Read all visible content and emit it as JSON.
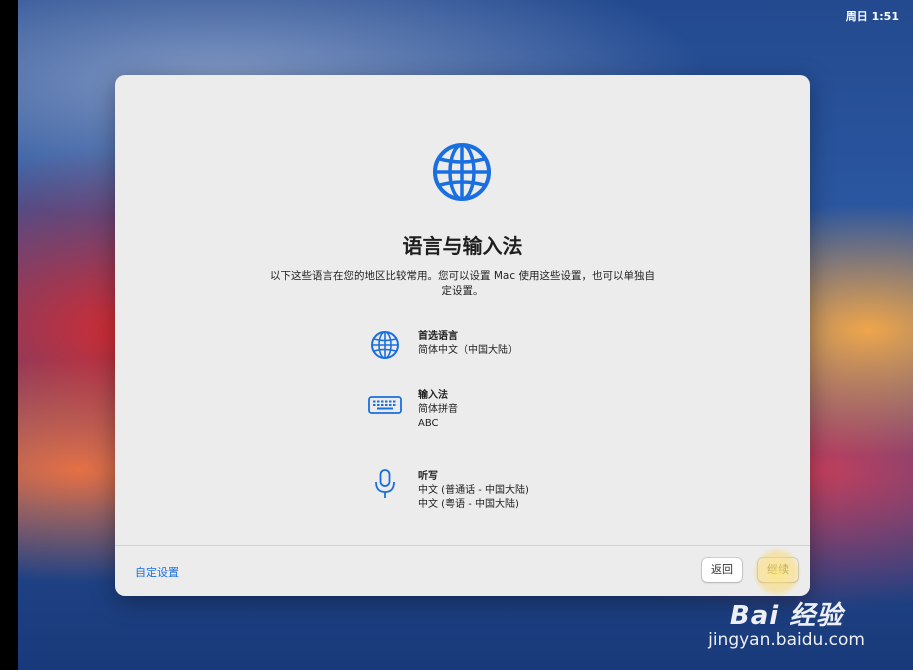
{
  "menubar": {
    "clock": "周日 1:51"
  },
  "dialog": {
    "title": "语言与输入法",
    "description": "以下这些语言在您的地区比较常用。您可以设置 Mac 使用这些设置，也可以单独自定设置。",
    "sections": [
      {
        "icon": "globe-icon",
        "heading": "首选语言",
        "lines": [
          "简体中文（中国大陆）"
        ]
      },
      {
        "icon": "keyboard-icon",
        "heading": "输入法",
        "lines": [
          "简体拼音",
          "ABC"
        ]
      },
      {
        "icon": "microphone-icon",
        "heading": "听写",
        "lines": [
          "中文 (普通话 - 中国大陆)",
          "中文 (粤语 - 中国大陆)"
        ]
      }
    ],
    "customize_link": "自定设置",
    "back_button": "返回",
    "continue_button": "继续"
  },
  "watermark": {
    "brand": "Bai 经验",
    "url": "jingyan.baidu.com"
  },
  "colors": {
    "accent": "#1a6fe0",
    "dialog_bg": "#ececec"
  }
}
